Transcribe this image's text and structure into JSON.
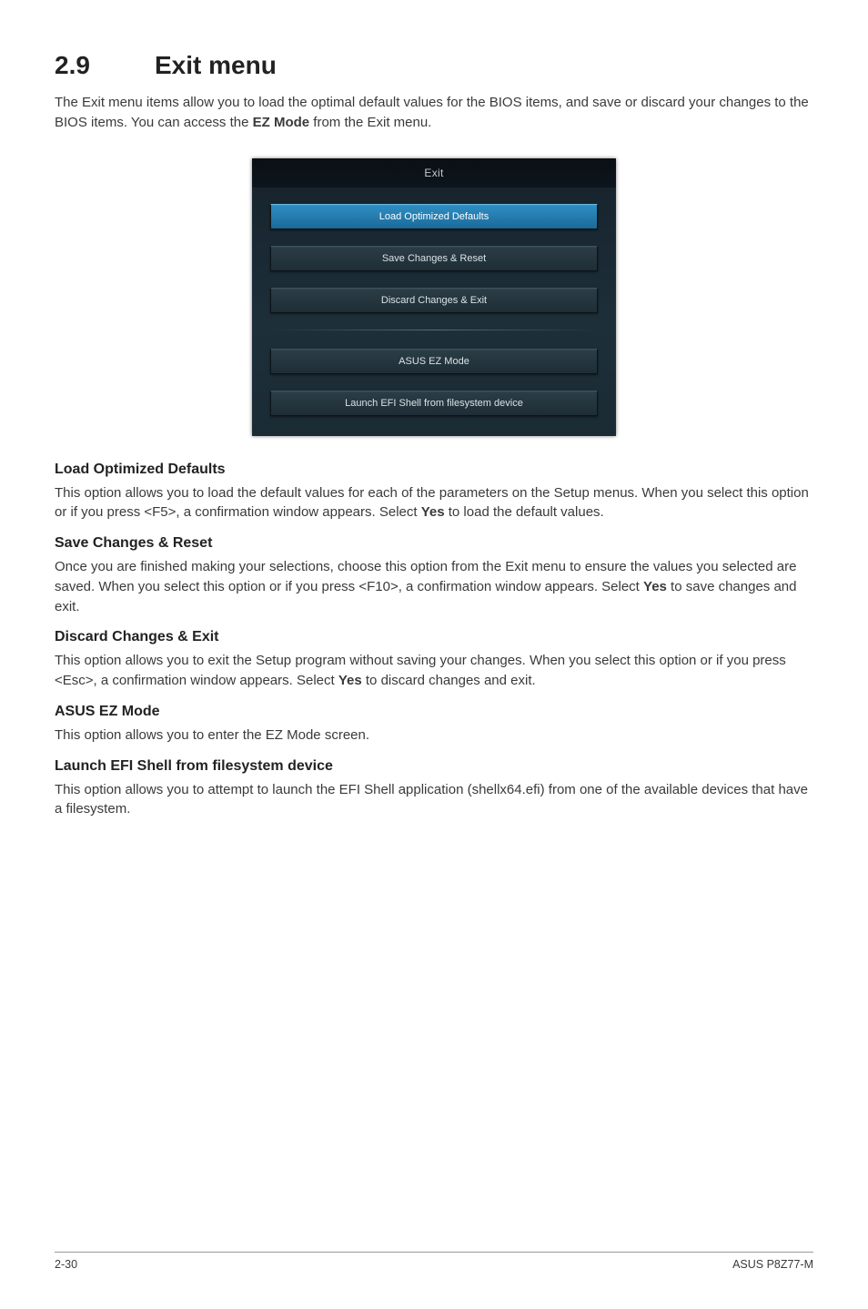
{
  "section": {
    "number": "2.9",
    "title": "Exit menu"
  },
  "intro_parts": {
    "a": "The Exit menu items allow you to load the optimal default values for the BIOS items, and save or discard your changes to the BIOS items. You can access the ",
    "b": "EZ Mode",
    "c": " from the Exit menu."
  },
  "bios": {
    "header": "Exit",
    "items": [
      "Load Optimized Defaults",
      "Save Changes & Reset",
      "Discard Changes & Exit",
      "ASUS EZ Mode",
      "Launch EFI Shell from filesystem device"
    ]
  },
  "sections": {
    "lod": {
      "title": "Load Optimized Defaults",
      "p_a": "This option allows you to load the default values for each of the parameters on the Setup menus. When you select this option or if you press <F5>, a confirmation window appears. Select ",
      "p_b": "Yes",
      "p_c": " to load the default values."
    },
    "scr": {
      "title": "Save Changes & Reset",
      "p_a": "Once you are finished making your selections, choose this option from the Exit menu to ensure the values you selected are saved. When you select this option or if you press <F10>, a confirmation window appears. Select ",
      "p_b": "Yes",
      "p_c": " to save changes and exit."
    },
    "dce": {
      "title": "Discard Changes & Exit",
      "p_a": "This option allows you to exit the Setup program without saving your changes. When you select this option or if you press <Esc>, a confirmation window appears. Select ",
      "p_b": "Yes",
      "p_c": " to discard changes and exit."
    },
    "ez": {
      "title": "ASUS EZ Mode",
      "p": "This option allows you to enter the EZ Mode screen."
    },
    "efi": {
      "title": "Launch EFI Shell from filesystem device",
      "p": "This option allows you to attempt to launch the EFI Shell application (shellx64.efi) from one of the available devices that have a filesystem."
    }
  },
  "footer": {
    "left": "2-30",
    "right": "ASUS P8Z77-M"
  }
}
